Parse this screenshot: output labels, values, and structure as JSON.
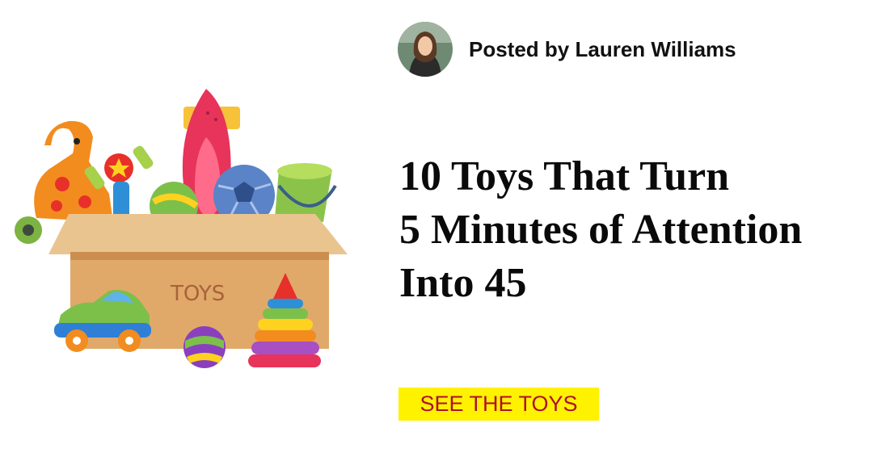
{
  "post": {
    "author_label": "Posted by Lauren Williams",
    "title_lines": [
      "10 Toys That Turn",
      "5 Minutes of Attention",
      "Into 45"
    ],
    "cta_label": "SEE THE TOYS"
  },
  "illustration": {
    "box_label": "TOYS",
    "description_icon": "toy-box-icon"
  },
  "colors": {
    "cta_background": "#fff200",
    "cta_text": "#b0102a",
    "title_text": "#0a0a0a",
    "box": "#e0a96a"
  }
}
